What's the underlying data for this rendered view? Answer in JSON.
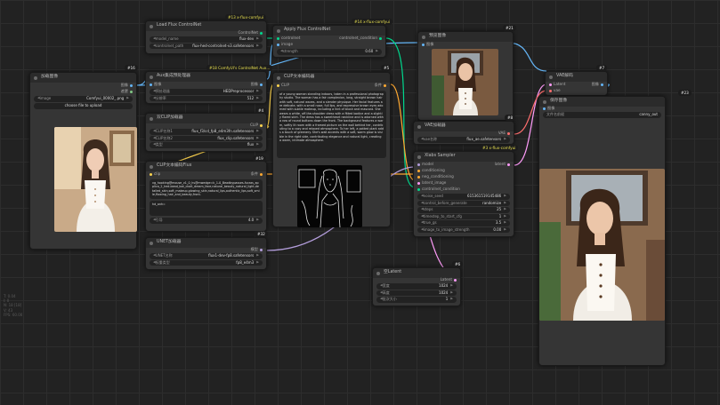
{
  "canvas": {
    "hint": "T: 0.04\nI: 0\nN: 18 [18]\nV: 43\nFPS: 60.00"
  },
  "nodes": {
    "load_image": {
      "title": "加载图像",
      "badge": "#16",
      "outputs": [
        "图像",
        "遮罩"
      ],
      "widgets": [
        {
          "label": "image",
          "value": "Comfyui_00002_.png"
        }
      ],
      "upload_label": "choose file to upload"
    },
    "load_flux_controlnet": {
      "title": "Load Flux ControlNet",
      "badge": "#13 x-flux-comfyui",
      "output": "ControlNet",
      "widgets": [
        {
          "label": "model_name",
          "value": "flux-dev"
        },
        {
          "label": "controlnet_path",
          "value": "flux-hed-controlnet-v3.safetensors"
        }
      ]
    },
    "aux_preprocessor": {
      "title": "Aux集成预处理器",
      "badge": "#18 ComfyUI's ControlNet Aux...",
      "input": "图像",
      "output": "图像",
      "widgets": [
        {
          "label": "预处理器",
          "value": "HEDPreprocessor"
        },
        {
          "label": "分辨率",
          "value": "512"
        }
      ]
    },
    "dual_clip": {
      "title": "双CLIP加载器",
      "badge": "#4",
      "output": "CLIP",
      "widgets": [
        {
          "label": "CLIP名称1",
          "value": "flux_f3/cd_fp8_e4m3fn.safetensors"
        },
        {
          "label": "CLIP名称2",
          "value": "flux_clip.safetensors"
        },
        {
          "label": "类型",
          "value": "flux"
        }
      ]
    },
    "clip_encode_flux": {
      "title": "CLIP文本编码Flux",
      "badge": "#19",
      "input": "clip",
      "output": "条件",
      "clip_l": "vg_hooking@mouse_v1_0_hs@mwedge=k_1-0_Beadbypasses-furzas_applica_2_hed-bead_bot_ckalt_dream_face,natural_beauty_natural_light,detailed_skin,soft_makeup,glowing_skin,natural_lips,authentic_lips,soft_smile,flowing_hair_and_beauty,front.",
      "t5xxl": "hd_anh=",
      "guidance_label": "引导",
      "guidance_value": "4.0"
    },
    "unet_loader": {
      "title": "UNET加载器",
      "badge": "#32",
      "output": "模型",
      "widgets": [
        {
          "label": "UNET名称",
          "value": "flux1-dev-fp8.safetensors"
        },
        {
          "label": "权重类型",
          "value": "fp8_e4m3"
        }
      ]
    },
    "apply_flux_controlnet": {
      "title": "Apply Flux ControlNet",
      "badge": "#14 x-flux-comfyui",
      "inputs": [
        "controlnet",
        "image"
      ],
      "output": "controlnet_condition",
      "widgets": [
        {
          "label": "strength",
          "value": "0.60"
        }
      ]
    },
    "clip_encode": {
      "title": "CLIP文本编码器",
      "badge": "#5",
      "input": "CLIP",
      "output": "条件",
      "text": "of a young woman standing indoors, taken in a professional photography studio. The woman has a fair complexion, long, straight brown hair with soft, natural waves, and a slender physique. Her facial features are delicate, with a small nose, full lips, and expressive brown eyes adorned with subtle makeup, including a hint of blush and mascara. She wears a white, off-the-shoulder dress with a fitted bodice and a slightly flared skirt. The dress has a sweetheart neckline and is adorned with a row of round buttons down the front. The background features a warm, softly lit room with a framed picture on the wall behind her, contributing to a cozy and relaxed atmosphere. To her left, a potted plant adds a touch of greenery. She's wall accents with a soft, warm glow is visible in the right side, contributing elegance and natural light, creating a warm, intimate atmosphere."
    },
    "preview_image_top": {
      "title": "预览图像",
      "badge": "#21",
      "input": "图像"
    },
    "vae_loader": {
      "title": "VAE加载器",
      "badge": "#8",
      "output": "VAE",
      "widgets": [
        {
          "label": "vae名称",
          "value": "flux_ae.safetensors"
        }
      ]
    },
    "xlabs_sampler": {
      "title": "Xlabs Sampler",
      "badge": "#3 x-flux-comfyui",
      "inputs": [
        "model",
        "conditioning",
        "neg_conditioning",
        "latent_image",
        "controlnet_condition"
      ],
      "output": "latent",
      "widgets": [
        {
          "label": "noise_seed",
          "value": "615361519145486"
        },
        {
          "label": "control_before_generate",
          "value": "randomize"
        },
        {
          "label": "steps",
          "value": "25"
        },
        {
          "label": "timestep_to_start_cfg",
          "value": "1"
        },
        {
          "label": "true_gs",
          "value": "3.5"
        },
        {
          "label": "image_to_image_strength",
          "value": "0.00"
        }
      ]
    },
    "empty_latent": {
      "title": "空Latent",
      "badge": "#6",
      "output": "Latent",
      "widgets": [
        {
          "label": "宽度",
          "value": "1024"
        },
        {
          "label": "高度",
          "value": "1024"
        },
        {
          "label": "批次大小",
          "value": "1"
        }
      ]
    },
    "vae_decode": {
      "title": "VAE解码",
      "badge": "#7",
      "inputs": [
        "Latent",
        "vae"
      ],
      "output": "图像"
    },
    "save_image": {
      "title": "保存图像",
      "badge": "#23",
      "input": "图像",
      "widgets": [
        {
          "label": "文件名前缀",
          "value": "canny_out"
        }
      ]
    }
  },
  "pin_colors": {
    "image": "#64b5f6",
    "clip": "#ffd54f",
    "conditioning": "#ffa931",
    "model": "#b39ddb",
    "vae": "#ff6e6e",
    "latent": "#ff9cf9",
    "controlnet": "#00d78d"
  }
}
